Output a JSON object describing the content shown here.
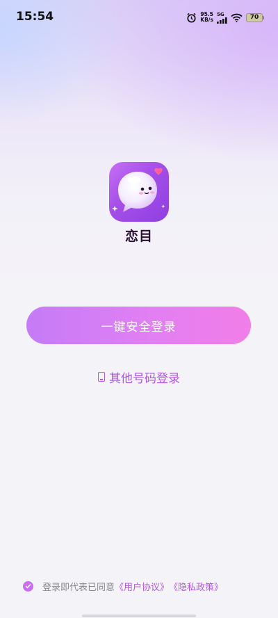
{
  "status_bar": {
    "time": "15:54",
    "speed_value": "95.5",
    "speed_unit": "KB/s",
    "network": "5G",
    "battery": "70",
    "icons": [
      "alarm-icon",
      "signal-icon",
      "wifi-icon",
      "battery-icon"
    ]
  },
  "app": {
    "name": "恋目",
    "logo_icon": "ghost-chat-bubble-icon"
  },
  "login": {
    "one_click_label": "一键安全登录",
    "other_phone_label": "其他号码登录",
    "other_phone_icon": "phone-icon"
  },
  "agreement": {
    "checked": true,
    "prefix": "登录即代表已同意",
    "user_agreement": "《用户协议》",
    "privacy_policy": "《隐私政策》"
  },
  "colors": {
    "accent": "#b356e2",
    "button_start": "#c47cf6",
    "button_end": "#f27ee7"
  }
}
